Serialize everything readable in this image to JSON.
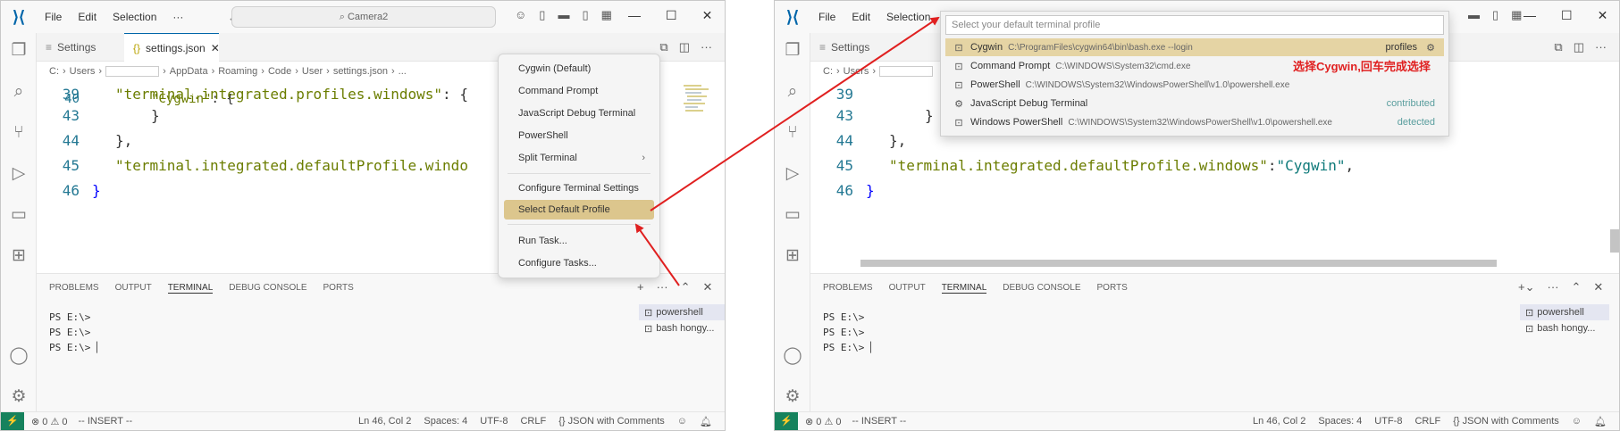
{
  "left": {
    "menu": [
      "File",
      "Edit",
      "Selection",
      "···"
    ],
    "search_text": "Camera2",
    "tabs": [
      {
        "label": "Settings"
      },
      {
        "label": "settings.json"
      }
    ],
    "breadcrumb": [
      "C:",
      "Users",
      "AppData",
      "Roaming",
      "Code",
      "User",
      "settings.json",
      "..."
    ],
    "lines": [
      {
        "num": "39",
        "key": "\"terminal.integrated.profiles.windows\"",
        "rest": ": {"
      },
      {
        "num": "40",
        "key": "\"Cygwin\"",
        "rest": ": {"
      },
      {
        "num": "43",
        "rest": "}"
      },
      {
        "num": "44",
        "rest": "},"
      },
      {
        "num": "45",
        "key": "\"terminal.integrated.defaultProfile.windo"
      },
      {
        "num": "46",
        "rest": "}"
      }
    ],
    "panel_tabs": [
      "PROBLEMS",
      "OUTPUT",
      "TERMINAL",
      "DEBUG CONSOLE",
      "PORTS"
    ],
    "terminal_lines": [
      "PS E:\\>",
      "PS E:\\>",
      "PS E:\\> "
    ],
    "terminal_list": [
      "powershell",
      "bash hongy..."
    ],
    "context_menu": [
      "Cygwin (Default)",
      "Command Prompt",
      "JavaScript Debug Terminal",
      "PowerShell",
      "Split Terminal",
      "Configure Terminal Settings",
      "Select Default Profile",
      "Run Task...",
      "Configure Tasks..."
    ],
    "status_left": [
      "⊗ 0 ⚠ 0",
      "-- INSERT --"
    ],
    "status_right": [
      "Ln 46, Col 2",
      "Spaces: 4",
      "UTF-8",
      "CRLF",
      "{} JSON with Comments"
    ]
  },
  "right": {
    "menu": [
      "File",
      "Edit",
      "Selection"
    ],
    "tabs": [
      {
        "label": "Settings"
      }
    ],
    "breadcrumb": [
      "C:",
      "Users"
    ],
    "lines": [
      {
        "num": "39"
      },
      {
        "num": "43",
        "rest": "}"
      },
      {
        "num": "44",
        "rest": "},"
      },
      {
        "num": "45",
        "key": "\"terminal.integrated.defaultProfile.windows\"",
        "colon": ": ",
        "val": "\"Cygwin\"",
        "comma": ","
      },
      {
        "num": "46",
        "rest": "}"
      }
    ],
    "panel_tabs": [
      "PROBLEMS",
      "OUTPUT",
      "TERMINAL",
      "DEBUG CONSOLE",
      "PORTS"
    ],
    "terminal_lines": [
      "PS E:\\>",
      "PS E:\\>",
      "PS E:\\> "
    ],
    "terminal_list": [
      "powershell",
      "bash hongy..."
    ],
    "quickpick": {
      "placeholder": "Select your default terminal profile",
      "items": [
        {
          "name": "Cygwin",
          "path": "C:\\ProgramFiles\\cygwin64\\bin\\bash.exe --login",
          "tag": "profiles"
        },
        {
          "name": "Command Prompt",
          "path": "C:\\WINDOWS\\System32\\cmd.exe",
          "tag": ""
        },
        {
          "name": "PowerShell",
          "path": "C:\\WINDOWS\\System32\\WindowsPowerShell\\v1.0\\powershell.exe",
          "tag": ""
        },
        {
          "name": "JavaScript Debug Terminal",
          "path": "",
          "tag": "contributed"
        },
        {
          "name": "Windows PowerShell",
          "path": "C:\\WINDOWS\\System32\\WindowsPowerShell\\v1.0\\powershell.exe",
          "tag": "detected"
        }
      ]
    },
    "annotation": "选择Cygwin,回车完成选择",
    "status_left": [
      "⊗ 0 ⚠ 0",
      "-- INSERT --"
    ],
    "status_right": [
      "Ln 46, Col 2",
      "Spaces: 4",
      "UTF-8",
      "CRLF",
      "{} JSON with Comments"
    ]
  },
  "colors": {
    "accent": "#0065a9",
    "highlight": "#dcc68d",
    "annotation_red": "#e02020",
    "string_teal": "#0f7a7a",
    "key_olive": "#6b7d00"
  }
}
